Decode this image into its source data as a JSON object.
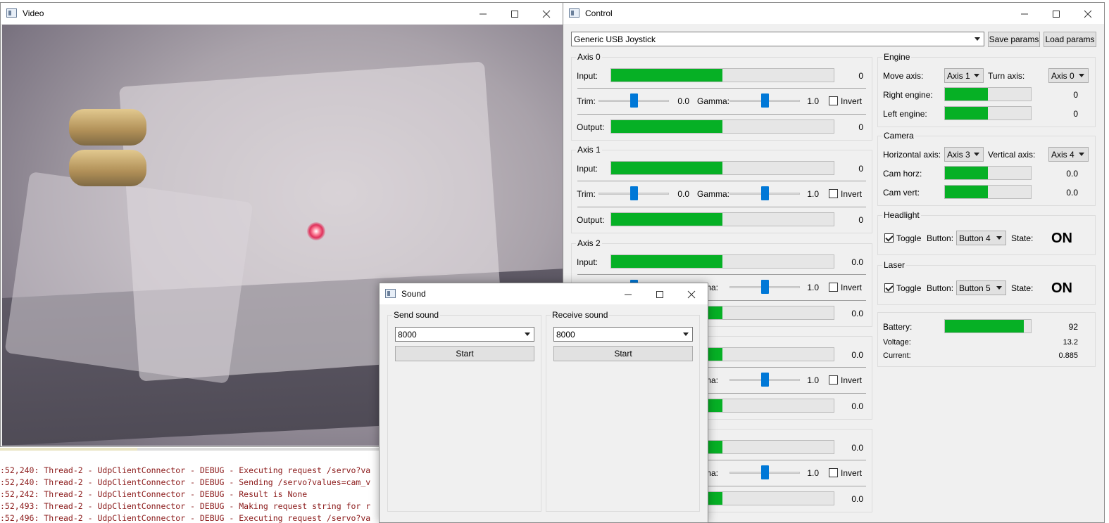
{
  "video": {
    "title": "Video"
  },
  "console": {
    "lines": [
      ":52,240: Thread-2 - UdpClientConnector - DEBUG - Executing request /servo?va",
      ":52,240: Thread-2 - UdpClientConnector - DEBUG - Sending /servo?values=cam_v",
      ":52,242: Thread-2 - UdpClientConnector - DEBUG - Result is None",
      ":52,493: Thread-2 - UdpClientConnector - DEBUG - Making request string for r",
      ":52,496: Thread-2 - UdpClientConnector - DEBUG - Executing request /servo?va"
    ]
  },
  "control": {
    "title": "Control",
    "joystick": "Generic  USB  Joystick",
    "save_params": "Save params",
    "load_params": "Load params",
    "axes": [
      {
        "title": "Axis 0",
        "input_label": "Input:",
        "input_value": "0",
        "input_level": 0.5,
        "trim_label": "Trim:",
        "trim_value": "0.0",
        "trim_level": 0.5,
        "gamma_label": "Gamma:",
        "gamma_value": "1.0",
        "gamma_level": 0.5,
        "invert_label": "Invert",
        "output_label": "Output:",
        "output_value": "0",
        "output_level": 0.5
      },
      {
        "title": "Axis 1",
        "input_label": "Input:",
        "input_value": "0",
        "input_level": 0.5,
        "trim_label": "Trim:",
        "trim_value": "0.0",
        "trim_level": 0.5,
        "gamma_label": "Gamma:",
        "gamma_value": "1.0",
        "gamma_level": 0.5,
        "invert_label": "Invert",
        "output_label": "Output:",
        "output_value": "0",
        "output_level": 0.5
      },
      {
        "title": "Axis 2",
        "input_label": "Input:",
        "input_value": "0.0",
        "input_level": 0.5,
        "trim_label": "",
        "trim_value": "",
        "trim_level": 0.5,
        "gamma_label": "mma:",
        "gamma_value": "1.0",
        "gamma_level": 0.5,
        "invert_label": "Invert",
        "output_label": "",
        "output_value": "0.0",
        "output_level": 0.5
      },
      {
        "title": "",
        "input_label": "",
        "input_value": "0.0",
        "input_level": 0.5,
        "trim_label": "",
        "trim_value": "",
        "trim_level": 0.5,
        "gamma_label": "mma:",
        "gamma_value": "1.0",
        "gamma_level": 0.5,
        "invert_label": "Invert",
        "output_label": "",
        "output_value": "0.0",
        "output_level": 0.5
      },
      {
        "title": "",
        "input_label": "",
        "input_value": "0.0",
        "input_level": 0.5,
        "trim_label": "",
        "trim_value": "",
        "trim_level": 0.5,
        "gamma_label": "mma:",
        "gamma_value": "1.0",
        "gamma_level": 0.5,
        "invert_label": "Invert",
        "output_label": "",
        "output_value": "0.0",
        "output_level": 0.5
      }
    ],
    "engine": {
      "title": "Engine",
      "move_axis_label": "Move axis:",
      "move_axis": "Axis 1",
      "turn_axis_label": "Turn axis:",
      "turn_axis": "Axis 0",
      "right_label": "Right engine:",
      "right_value": "0",
      "right_level": 0.5,
      "left_label": "Left engine:",
      "left_value": "0",
      "left_level": 0.5
    },
    "camera": {
      "title": "Camera",
      "horizontal_label": "Horizontal axis:",
      "horizontal_axis": "Axis 3",
      "vertical_label": "Vertical axis:",
      "vertical_axis": "Axis 4",
      "horz_label": "Cam horz:",
      "horz_value": "0.0",
      "horz_level": 0.5,
      "vert_label": "Cam vert:",
      "vert_value": "0.0",
      "vert_level": 0.5
    },
    "headlight": {
      "title": "Headlight",
      "toggle_label": "Toggle",
      "button_label": "Button:",
      "button": "Button 4",
      "state_label": "State:",
      "state": "ON"
    },
    "laser": {
      "title": "Laser",
      "toggle_label": "Toggle",
      "button_label": "Button:",
      "button": "Button 5",
      "state_label": "State:",
      "state": "ON"
    },
    "power": {
      "battery_label": "Battery:",
      "battery_value": "92",
      "battery_level": 0.92,
      "voltage_label": "Voltage:",
      "voltage_value": "13.2",
      "current_label": "Current:",
      "current_value": "0.885"
    }
  },
  "sound": {
    "title": "Sound",
    "send": {
      "title": "Send sound",
      "rate": "8000",
      "start": "Start"
    },
    "receive": {
      "title": "Receive sound",
      "rate": "8000",
      "start": "Start"
    }
  }
}
